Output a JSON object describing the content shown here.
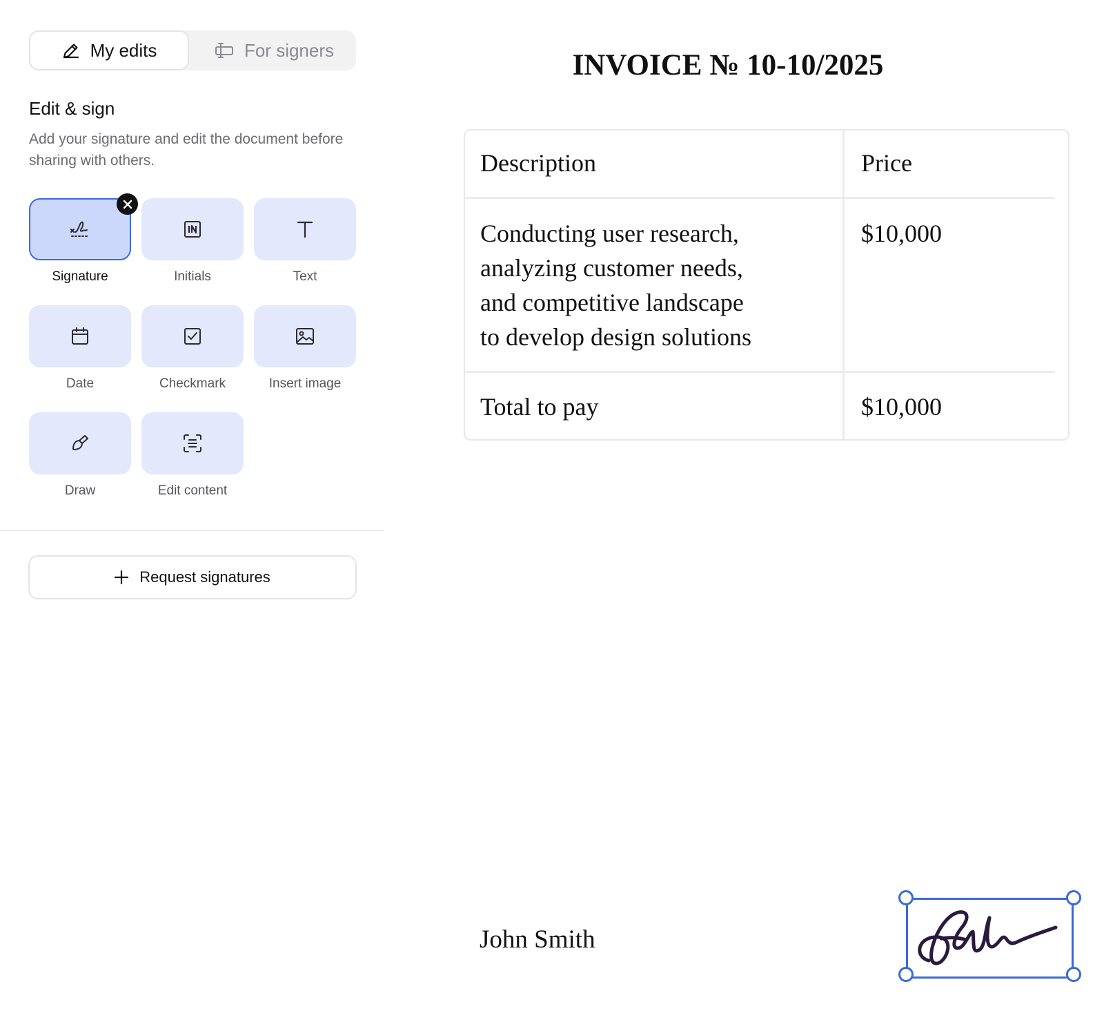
{
  "mode_tabs": [
    {
      "label": "My edits",
      "icon": "pencil-icon",
      "active": true
    },
    {
      "label": "For signers",
      "icon": "signers-field-icon",
      "active": false
    }
  ],
  "section": {
    "title": "Edit & sign",
    "description": "Add your signature and edit the document before sharing with others."
  },
  "tools": [
    {
      "label": "Signature",
      "icon": "signature-icon",
      "selected": true
    },
    {
      "label": "Initials",
      "icon": "initials-icon",
      "selected": false
    },
    {
      "label": "Text",
      "icon": "text-icon",
      "selected": false
    },
    {
      "label": "Date",
      "icon": "calendar-icon",
      "selected": false
    },
    {
      "label": "Checkmark",
      "icon": "checkmark-icon",
      "selected": false
    },
    {
      "label": "Insert image",
      "icon": "image-icon",
      "selected": false
    },
    {
      "label": "Draw",
      "icon": "brush-icon",
      "selected": false
    },
    {
      "label": "Edit content",
      "icon": "edit-content-icon",
      "selected": false
    }
  ],
  "request_button": {
    "label": "Request signatures",
    "icon": "plus-icon"
  },
  "document": {
    "title": "INVOICE № 10-10/2025",
    "table": {
      "headers": [
        "Description",
        "Price"
      ],
      "rows": [
        {
          "description_lines": [
            "Conducting user research,",
            "analyzing customer needs,",
            "and competitive landscape",
            "to develop design solutions"
          ],
          "price": "$10,000"
        }
      ],
      "total": {
        "label": "Total to pay",
        "price": "$10,000"
      }
    },
    "signer_name": "John Smith"
  },
  "colors": {
    "accent": "#3a6ad6",
    "tool_bg": "#e3e8fd",
    "tool_selected_bg": "#cbd7fb",
    "signature_ink": "#2a1a3e"
  }
}
